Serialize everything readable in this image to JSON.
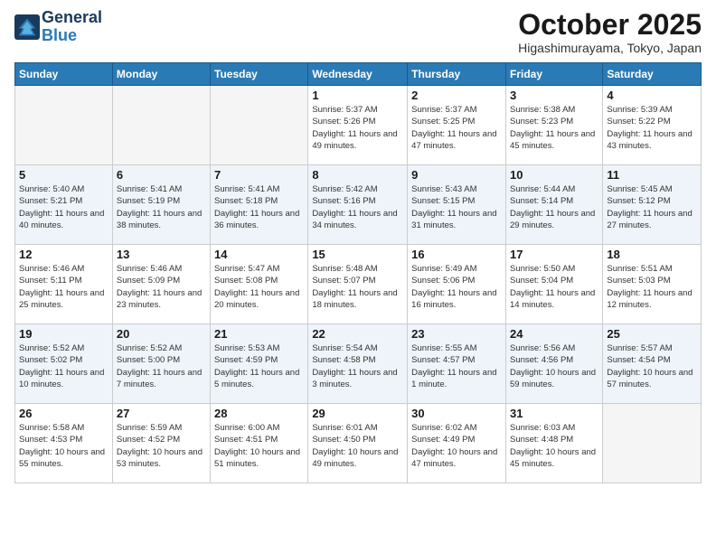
{
  "header": {
    "logo_line1": "General",
    "logo_line2": "Blue",
    "month_title": "October 2025",
    "location": "Higashimurayama, Tokyo, Japan"
  },
  "days_of_week": [
    "Sunday",
    "Monday",
    "Tuesday",
    "Wednesday",
    "Thursday",
    "Friday",
    "Saturday"
  ],
  "weeks": [
    {
      "alt": false,
      "days": [
        {
          "num": "",
          "info": ""
        },
        {
          "num": "",
          "info": ""
        },
        {
          "num": "",
          "info": ""
        },
        {
          "num": "1",
          "info": "Sunrise: 5:37 AM\nSunset: 5:26 PM\nDaylight: 11 hours\nand 49 minutes."
        },
        {
          "num": "2",
          "info": "Sunrise: 5:37 AM\nSunset: 5:25 PM\nDaylight: 11 hours\nand 47 minutes."
        },
        {
          "num": "3",
          "info": "Sunrise: 5:38 AM\nSunset: 5:23 PM\nDaylight: 11 hours\nand 45 minutes."
        },
        {
          "num": "4",
          "info": "Sunrise: 5:39 AM\nSunset: 5:22 PM\nDaylight: 11 hours\nand 43 minutes."
        }
      ]
    },
    {
      "alt": true,
      "days": [
        {
          "num": "5",
          "info": "Sunrise: 5:40 AM\nSunset: 5:21 PM\nDaylight: 11 hours\nand 40 minutes."
        },
        {
          "num": "6",
          "info": "Sunrise: 5:41 AM\nSunset: 5:19 PM\nDaylight: 11 hours\nand 38 minutes."
        },
        {
          "num": "7",
          "info": "Sunrise: 5:41 AM\nSunset: 5:18 PM\nDaylight: 11 hours\nand 36 minutes."
        },
        {
          "num": "8",
          "info": "Sunrise: 5:42 AM\nSunset: 5:16 PM\nDaylight: 11 hours\nand 34 minutes."
        },
        {
          "num": "9",
          "info": "Sunrise: 5:43 AM\nSunset: 5:15 PM\nDaylight: 11 hours\nand 31 minutes."
        },
        {
          "num": "10",
          "info": "Sunrise: 5:44 AM\nSunset: 5:14 PM\nDaylight: 11 hours\nand 29 minutes."
        },
        {
          "num": "11",
          "info": "Sunrise: 5:45 AM\nSunset: 5:12 PM\nDaylight: 11 hours\nand 27 minutes."
        }
      ]
    },
    {
      "alt": false,
      "days": [
        {
          "num": "12",
          "info": "Sunrise: 5:46 AM\nSunset: 5:11 PM\nDaylight: 11 hours\nand 25 minutes."
        },
        {
          "num": "13",
          "info": "Sunrise: 5:46 AM\nSunset: 5:09 PM\nDaylight: 11 hours\nand 23 minutes."
        },
        {
          "num": "14",
          "info": "Sunrise: 5:47 AM\nSunset: 5:08 PM\nDaylight: 11 hours\nand 20 minutes."
        },
        {
          "num": "15",
          "info": "Sunrise: 5:48 AM\nSunset: 5:07 PM\nDaylight: 11 hours\nand 18 minutes."
        },
        {
          "num": "16",
          "info": "Sunrise: 5:49 AM\nSunset: 5:06 PM\nDaylight: 11 hours\nand 16 minutes."
        },
        {
          "num": "17",
          "info": "Sunrise: 5:50 AM\nSunset: 5:04 PM\nDaylight: 11 hours\nand 14 minutes."
        },
        {
          "num": "18",
          "info": "Sunrise: 5:51 AM\nSunset: 5:03 PM\nDaylight: 11 hours\nand 12 minutes."
        }
      ]
    },
    {
      "alt": true,
      "days": [
        {
          "num": "19",
          "info": "Sunrise: 5:52 AM\nSunset: 5:02 PM\nDaylight: 11 hours\nand 10 minutes."
        },
        {
          "num": "20",
          "info": "Sunrise: 5:52 AM\nSunset: 5:00 PM\nDaylight: 11 hours\nand 7 minutes."
        },
        {
          "num": "21",
          "info": "Sunrise: 5:53 AM\nSunset: 4:59 PM\nDaylight: 11 hours\nand 5 minutes."
        },
        {
          "num": "22",
          "info": "Sunrise: 5:54 AM\nSunset: 4:58 PM\nDaylight: 11 hours\nand 3 minutes."
        },
        {
          "num": "23",
          "info": "Sunrise: 5:55 AM\nSunset: 4:57 PM\nDaylight: 11 hours\nand 1 minute."
        },
        {
          "num": "24",
          "info": "Sunrise: 5:56 AM\nSunset: 4:56 PM\nDaylight: 10 hours\nand 59 minutes."
        },
        {
          "num": "25",
          "info": "Sunrise: 5:57 AM\nSunset: 4:54 PM\nDaylight: 10 hours\nand 57 minutes."
        }
      ]
    },
    {
      "alt": false,
      "days": [
        {
          "num": "26",
          "info": "Sunrise: 5:58 AM\nSunset: 4:53 PM\nDaylight: 10 hours\nand 55 minutes."
        },
        {
          "num": "27",
          "info": "Sunrise: 5:59 AM\nSunset: 4:52 PM\nDaylight: 10 hours\nand 53 minutes."
        },
        {
          "num": "28",
          "info": "Sunrise: 6:00 AM\nSunset: 4:51 PM\nDaylight: 10 hours\nand 51 minutes."
        },
        {
          "num": "29",
          "info": "Sunrise: 6:01 AM\nSunset: 4:50 PM\nDaylight: 10 hours\nand 49 minutes."
        },
        {
          "num": "30",
          "info": "Sunrise: 6:02 AM\nSunset: 4:49 PM\nDaylight: 10 hours\nand 47 minutes."
        },
        {
          "num": "31",
          "info": "Sunrise: 6:03 AM\nSunset: 4:48 PM\nDaylight: 10 hours\nand 45 minutes."
        },
        {
          "num": "",
          "info": ""
        }
      ]
    }
  ]
}
